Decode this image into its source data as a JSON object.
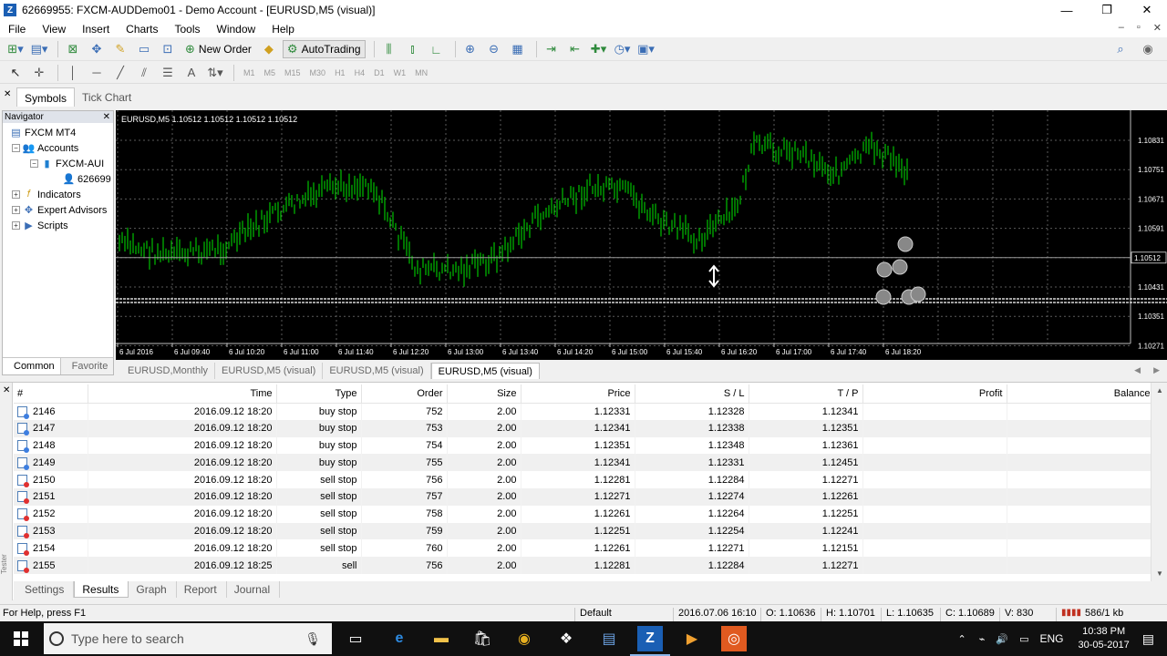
{
  "window": {
    "title": "62669955: FXCM-AUDDemo01 - Demo Account - [EURUSD,M5 (visual)]",
    "controls": [
      "—",
      "❐",
      "✕"
    ]
  },
  "menu": {
    "items": [
      "File",
      "View",
      "Insert",
      "Charts",
      "Tools",
      "Window",
      "Help"
    ]
  },
  "toolbar": {
    "new_order": "New Order",
    "autotrading": "AutoTrading",
    "timeframes": [
      "M1",
      "M5",
      "M15",
      "M30",
      "H1",
      "H4",
      "D1",
      "W1",
      "MN"
    ]
  },
  "symbols_bar": {
    "tabs": [
      "Symbols",
      "Tick Chart"
    ]
  },
  "navigator": {
    "title": "Navigator",
    "items": [
      "FXCM MT4",
      "Accounts",
      "FXCM-AUI",
      "626699",
      "Indicators",
      "Expert Advisors",
      "Scripts"
    ],
    "tabs": [
      "Common",
      "Favorite"
    ]
  },
  "chart": {
    "info": "EURUSD,M5  1.10512 1.10512 1.10512 1.10512",
    "price_labels": [
      "1.10831",
      "1.10751",
      "1.10671",
      "1.10591",
      "1.10512",
      "1.10431",
      "1.10351",
      "1.10271"
    ],
    "current_price": "1.10512",
    "time_labels": [
      "6 Jul 2016",
      "6 Jul 09:40",
      "6 Jul 10:20",
      "6 Jul 11:00",
      "6 Jul 11:40",
      "6 Jul 12:20",
      "6 Jul 13:00",
      "6 Jul 13:40",
      "6 Jul 14:20",
      "6 Jul 15:00",
      "6 Jul 15:40",
      "6 Jul 16:20",
      "6 Jul 17:00",
      "6 Jul 17:40",
      "6 Jul 18:20"
    ],
    "colors": {
      "background": "#000000",
      "bars": "#00c000",
      "grid": "#5a5a5a",
      "text": "#ffffff"
    }
  },
  "chart_tabs": [
    "EURUSD,Monthly",
    "EURUSD,M5 (visual)",
    "EURUSD,M5 (visual)",
    "EURUSD,M5 (visual)"
  ],
  "tester": {
    "columns": [
      "#",
      "Time",
      "Type",
      "Order",
      "Size",
      "Price",
      "S / L",
      "T / P",
      "Profit",
      "Balance"
    ],
    "rows": [
      {
        "num": "2146",
        "time": "2016.09.12 18:20",
        "type": "buy stop",
        "order": "752",
        "size": "2.00",
        "price": "1.12331",
        "sl": "1.12328",
        "tp": "1.12341",
        "side": "buy"
      },
      {
        "num": "2147",
        "time": "2016.09.12 18:20",
        "type": "buy stop",
        "order": "753",
        "size": "2.00",
        "price": "1.12341",
        "sl": "1.12338",
        "tp": "1.12351",
        "side": "buy"
      },
      {
        "num": "2148",
        "time": "2016.09.12 18:20",
        "type": "buy stop",
        "order": "754",
        "size": "2.00",
        "price": "1.12351",
        "sl": "1.12348",
        "tp": "1.12361",
        "side": "buy"
      },
      {
        "num": "2149",
        "time": "2016.09.12 18:20",
        "type": "buy stop",
        "order": "755",
        "size": "2.00",
        "price": "1.12341",
        "sl": "1.12331",
        "tp": "1.12451",
        "side": "buy"
      },
      {
        "num": "2150",
        "time": "2016.09.12 18:20",
        "type": "sell stop",
        "order": "756",
        "size": "2.00",
        "price": "1.12281",
        "sl": "1.12284",
        "tp": "1.12271",
        "side": "sell"
      },
      {
        "num": "2151",
        "time": "2016.09.12 18:20",
        "type": "sell stop",
        "order": "757",
        "size": "2.00",
        "price": "1.12271",
        "sl": "1.12274",
        "tp": "1.12261",
        "side": "sell"
      },
      {
        "num": "2152",
        "time": "2016.09.12 18:20",
        "type": "sell stop",
        "order": "758",
        "size": "2.00",
        "price": "1.12261",
        "sl": "1.12264",
        "tp": "1.12251",
        "side": "sell"
      },
      {
        "num": "2153",
        "time": "2016.09.12 18:20",
        "type": "sell stop",
        "order": "759",
        "size": "2.00",
        "price": "1.12251",
        "sl": "1.12254",
        "tp": "1.12241",
        "side": "sell"
      },
      {
        "num": "2154",
        "time": "2016.09.12 18:20",
        "type": "sell stop",
        "order": "760",
        "size": "2.00",
        "price": "1.12261",
        "sl": "1.12271",
        "tp": "1.12151",
        "side": "sell"
      },
      {
        "num": "2155",
        "time": "2016.09.12 18:25",
        "type": "sell",
        "order": "756",
        "size": "2.00",
        "price": "1.12281",
        "sl": "1.12284",
        "tp": "1.12271",
        "side": "sell"
      }
    ],
    "tabs": [
      "Settings",
      "Results",
      "Graph",
      "Report",
      "Journal"
    ],
    "side_label": "Tester"
  },
  "status": {
    "help": "For Help, press F1",
    "profile": "Default",
    "datetime": "2016.07.06 16:10",
    "open": "O: 1.10636",
    "high": "H: 1.10701",
    "low": "L: 1.10635",
    "close": "C: 1.10689",
    "volume": "V: 830",
    "traffic": "586/1 kb"
  },
  "taskbar": {
    "search_placeholder": "Type here to search",
    "language": "ENG",
    "time": "10:38 PM",
    "date": "30-05-2017"
  }
}
